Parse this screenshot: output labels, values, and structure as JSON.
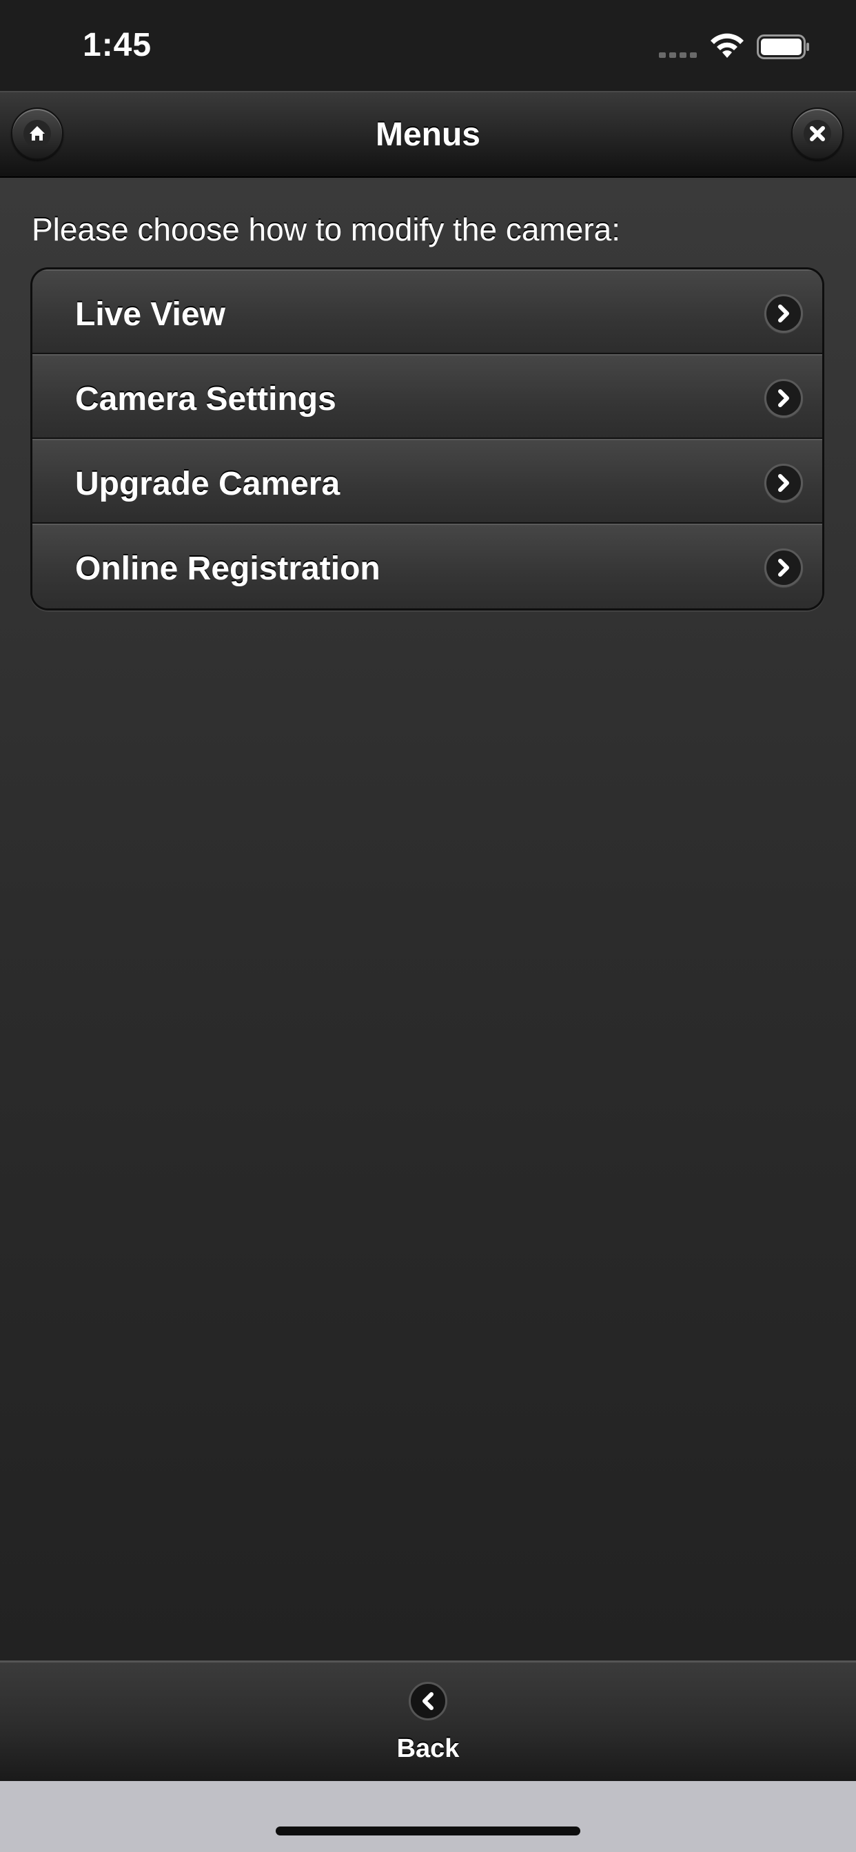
{
  "status_bar": {
    "time": "1:45",
    "icons": [
      "cellular-signal-icon",
      "wifi-icon",
      "battery-icon"
    ]
  },
  "header": {
    "title": "Menus",
    "left_button_icon": "home-icon",
    "right_button_icon": "close-icon"
  },
  "content": {
    "prompt": "Please choose how to modify the camera:",
    "menu_items": [
      {
        "label": "Live View",
        "icon": "chevron-right-icon"
      },
      {
        "label": "Camera Settings",
        "icon": "chevron-right-icon"
      },
      {
        "label": "Upgrade Camera",
        "icon": "chevron-right-icon"
      },
      {
        "label": "Online Registration",
        "icon": "chevron-right-icon"
      }
    ]
  },
  "footer": {
    "back_label": "Back",
    "back_icon": "chevron-left-icon"
  },
  "colors": {
    "background_top": "#3a3a3a",
    "background_bottom": "#222222",
    "text": "#ffffff",
    "home_indicator_area": "#c0c0c6"
  }
}
